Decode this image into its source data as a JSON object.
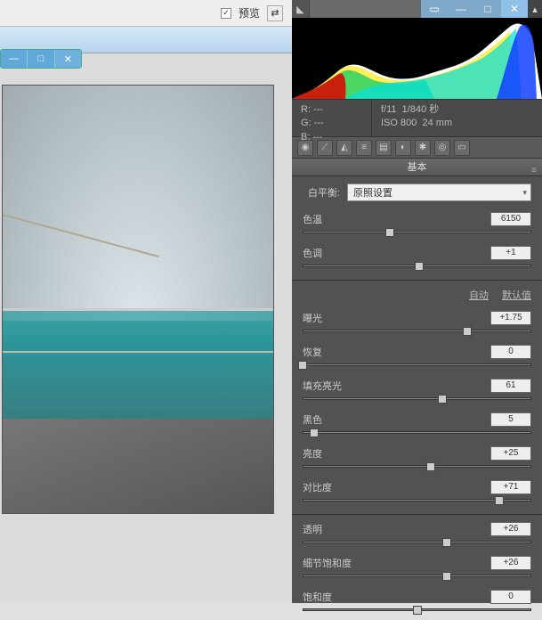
{
  "left": {
    "preview_label": "预览",
    "preview_checked": true
  },
  "right": {
    "meta": {
      "r": "R:  ---",
      "g": "G:  ---",
      "b": "B:  ---",
      "aperture": "f/11",
      "shutter": "1/840 秒",
      "iso": "ISO 800",
      "focal": "24 mm"
    },
    "section_title": "基本",
    "wb_label": "白平衡:",
    "wb_value": "原照设置",
    "auto_link": "自动",
    "default_link": "默认值",
    "sliders": {
      "temp": {
        "label": "色温",
        "value": "6150",
        "pos": 38
      },
      "tint": {
        "label": "色调",
        "value": "+1",
        "pos": 51
      },
      "exposure": {
        "label": "曝光",
        "value": "+1.75",
        "pos": 72
      },
      "recovery": {
        "label": "恢复",
        "value": "0",
        "pos": 0
      },
      "fill": {
        "label": "填充亮光",
        "value": "61",
        "pos": 61
      },
      "blacks": {
        "label": "黑色",
        "value": "5",
        "pos": 5
      },
      "brightness": {
        "label": "亮度",
        "value": "+25",
        "pos": 56
      },
      "contrast": {
        "label": "对比度",
        "value": "+71",
        "pos": 86
      },
      "clarity": {
        "label": "透明",
        "value": "+26",
        "pos": 63
      },
      "vibrance": {
        "label": "细节饱和度",
        "value": "+26",
        "pos": 63
      },
      "saturation": {
        "label": "饱和度",
        "value": "0",
        "pos": 50
      }
    }
  }
}
